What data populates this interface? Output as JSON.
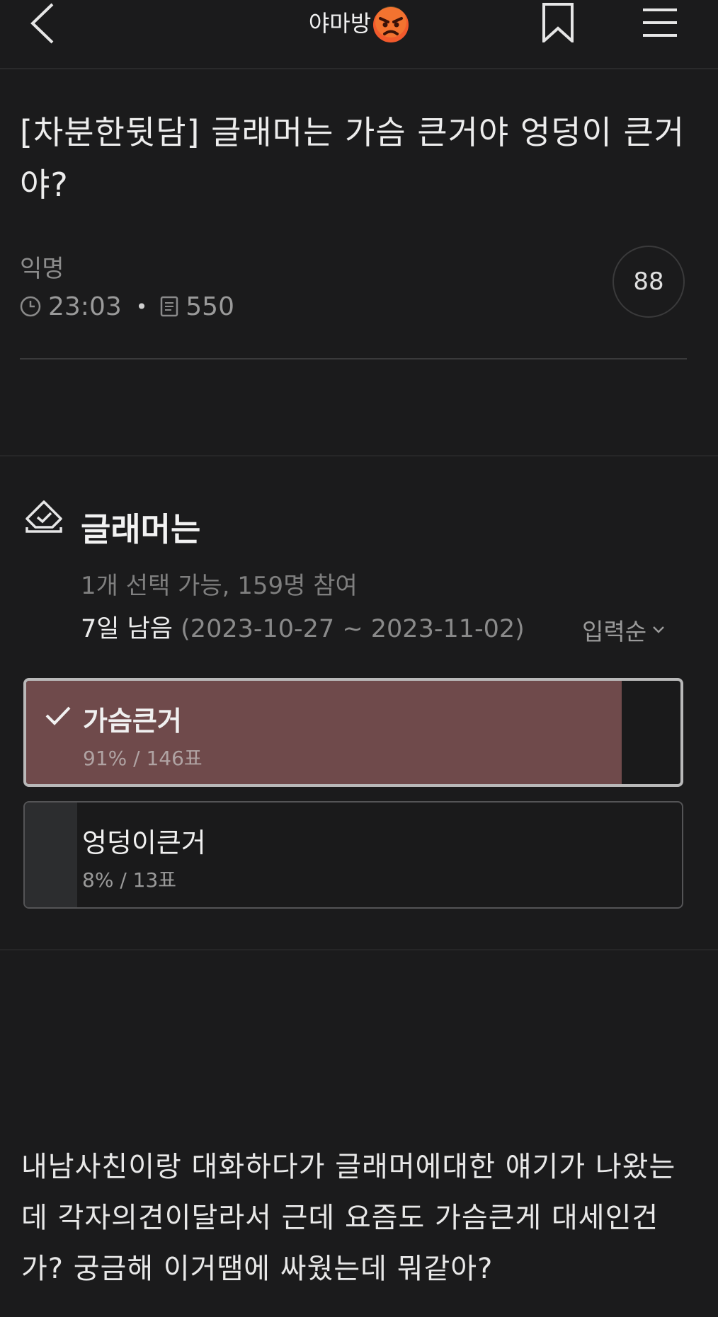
{
  "header": {
    "brand": "야마방",
    "brand_emoji": "angry-face"
  },
  "post": {
    "title": "[차분한뒷담] 글래머는 가슴 큰거야 엉덩이 큰거야?",
    "author": "익명",
    "time": "23:03",
    "views": "550",
    "comment_count": "88",
    "body": "내남사친이랑 대화하다가 글래머에대한 얘기가 나왔는데 각자의견이달라서 근데 요즘도 가슴큰게 대세인건가? 궁금해 이거땜에 싸웠는데 뭐같아?"
  },
  "poll": {
    "title": "글래머는",
    "info": "1개 선택 가능, 159명 참여",
    "remaining": "7일 남음",
    "period": "(2023-10-27 ~ 2023-11-02)",
    "sort_label": "입력순",
    "options": [
      {
        "label": "가슴큰거",
        "stat": "91% / 146표",
        "percent": 91,
        "selected": true
      },
      {
        "label": "엉덩이큰거",
        "stat": "8% / 13표",
        "percent": 8,
        "selected": false
      }
    ]
  },
  "colors": {
    "background": "#1b1b1c",
    "selected_fill": "#6f4a4b",
    "unselected_fill": "#2c2d2f"
  }
}
